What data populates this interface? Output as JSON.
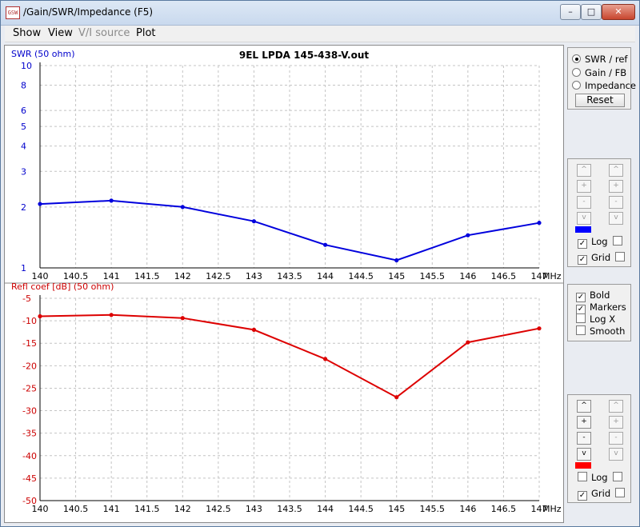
{
  "window": {
    "title": "/Gain/SWR/Impedance (F5)",
    "icon_label": "GSW",
    "controls": {
      "minimize": "–",
      "maximize": "□",
      "close": "✕"
    }
  },
  "menu": [
    {
      "label": "Show",
      "enabled": true
    },
    {
      "label": "View",
      "enabled": true
    },
    {
      "label": "V/I source",
      "enabled": false
    },
    {
      "label": "Plot",
      "enabled": true
    }
  ],
  "right_panel": {
    "plot_mode": {
      "options": [
        "SWR / ref",
        "Gain / FB",
        "Impedance"
      ],
      "selected": "SWR / ref",
      "reset_label": "Reset"
    },
    "top_scale": {
      "buttons": [
        "^",
        "+",
        "-",
        "v"
      ],
      "color": "#0000ff",
      "log_label": "Log",
      "log_checked": true,
      "grid_label": "Grid",
      "grid_checked": true
    },
    "options": [
      {
        "label": "Bold",
        "checked": true
      },
      {
        "label": "Markers",
        "checked": true
      },
      {
        "label": "Log X",
        "checked": false
      },
      {
        "label": "Smooth",
        "checked": false
      }
    ],
    "bottom_scale": {
      "buttons": [
        "^",
        "+",
        "-",
        "v"
      ],
      "color": "#ff0000",
      "log_label": "Log",
      "log_checked": false,
      "grid_label": "Grid",
      "grid_checked": true
    },
    "check_mark": "✓"
  },
  "chart_data": [
    {
      "type": "line",
      "title": "9EL LPDA 145-438-V.out",
      "ylabel": "SWR (50 ohm)",
      "xlabel": "MHz",
      "y_scale": "log",
      "ylim": [
        1,
        10
      ],
      "xlim": [
        140,
        147
      ],
      "grid": true,
      "color": "#0000dd",
      "x_ticks": [
        "140",
        "140.5",
        "141",
        "141.5",
        "142",
        "142.5",
        "143",
        "143.5",
        "144",
        "144.5",
        "145",
        "145.5",
        "146",
        "146.5",
        "147"
      ],
      "y_ticks": [
        "1",
        "2",
        "3",
        "4",
        "5",
        "6",
        "8",
        "10"
      ],
      "x": [
        140,
        141,
        142,
        143,
        144,
        145,
        146,
        147
      ],
      "values": [
        2.07,
        2.15,
        2.0,
        1.7,
        1.3,
        1.09,
        1.45,
        1.67
      ]
    },
    {
      "type": "line",
      "title": "",
      "ylabel": "Refl coef [dB] (50 ohm)",
      "xlabel": "MHz",
      "ylim": [
        -50,
        -5
      ],
      "xlim": [
        140,
        147
      ],
      "grid": true,
      "color": "#dd0000",
      "x_ticks": [
        "140",
        "140.5",
        "141",
        "141.5",
        "142",
        "142.5",
        "143",
        "143.5",
        "144",
        "144.5",
        "145",
        "145.5",
        "146",
        "146.5",
        "147"
      ],
      "y_ticks": [
        "-5",
        "-10",
        "-15",
        "-20",
        "-25",
        "-30",
        "-35",
        "-40",
        "-45",
        "-50"
      ],
      "x": [
        140,
        141,
        142,
        143,
        144,
        145,
        146,
        147
      ],
      "values": [
        -9.0,
        -8.7,
        -9.4,
        -12.0,
        -18.5,
        -27.0,
        -14.8,
        -11.7
      ]
    }
  ]
}
